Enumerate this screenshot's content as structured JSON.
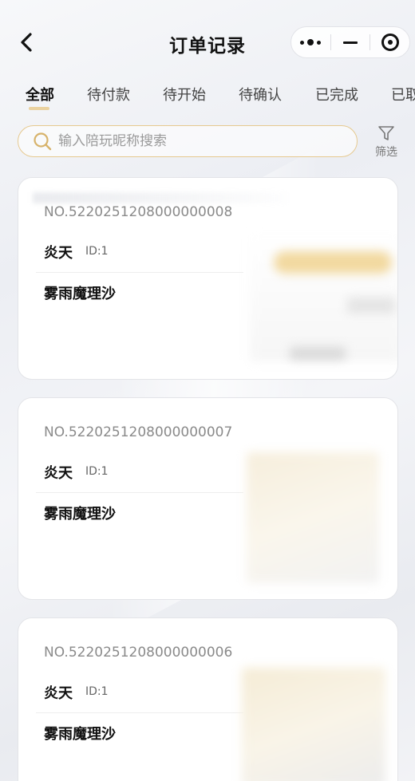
{
  "header": {
    "title": "订单记录",
    "back_icon": "chevron-left-icon",
    "capsule_icons": [
      "more-dots-icon",
      "minimize-icon",
      "target-close-icon"
    ]
  },
  "tabs": [
    {
      "label": "全部",
      "active": true
    },
    {
      "label": "待付款",
      "active": false
    },
    {
      "label": "待开始",
      "active": false
    },
    {
      "label": "待确认",
      "active": false
    },
    {
      "label": "已完成",
      "active": false
    },
    {
      "label": "已取消",
      "active": false
    }
  ],
  "search": {
    "placeholder": "输入陪玩昵称搜索",
    "value": "",
    "icon": "search-icon"
  },
  "filter": {
    "label": "筛选",
    "icon": "filter-funnel-icon"
  },
  "orders": [
    {
      "order_no": "NO.5220251208000000008",
      "player": "炎天",
      "player_id": "ID:1",
      "game": "雾雨魔理沙"
    },
    {
      "order_no": "NO.5220251208000000007",
      "player": "炎天",
      "player_id": "ID:1",
      "game": "雾雨魔理沙"
    },
    {
      "order_no": "NO.5220251208000000006",
      "player": "炎天",
      "player_id": "ID:1",
      "game": "雾雨魔理沙"
    }
  ],
  "colors": {
    "accent_gold": "#ead29f",
    "search_border": "#e6c98f",
    "text_primary": "#111111",
    "text_secondary": "#8a8a8a"
  }
}
